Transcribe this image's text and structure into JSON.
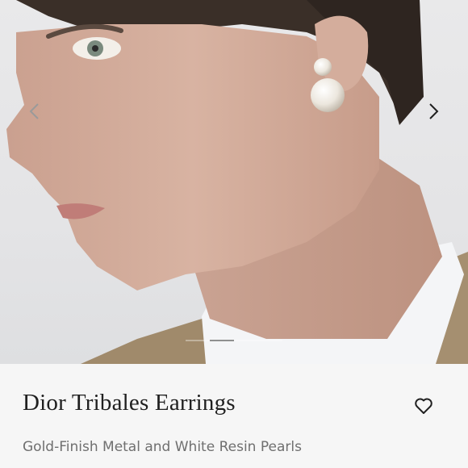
{
  "product": {
    "title": "Dior Tribales Earrings",
    "subtitle": "Gold-Finish Metal and White Resin Pearls"
  },
  "gallery": {
    "image_alt": "model-wearing-pearl-earrings",
    "slide_count": 4,
    "active_slide": 2
  },
  "icons": {
    "prev": "chevron-left-icon",
    "next": "chevron-right-icon",
    "favorite": "heart-outline-icon"
  },
  "colors": {
    "title_text": "#1f1f1f",
    "subtitle_text": "#6f6f6f",
    "background": "#f6f6f6"
  }
}
